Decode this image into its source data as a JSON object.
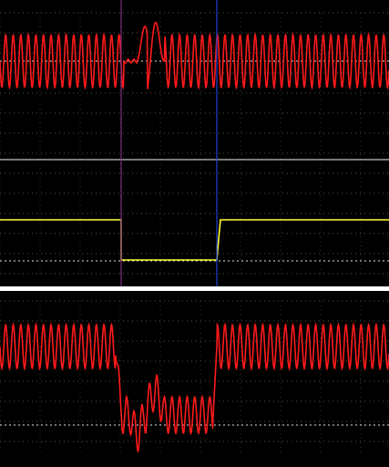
{
  "colors": {
    "background": "#000000",
    "grid": "#3a3a3a",
    "trace_red": "#ff1a1a",
    "trace_yellow": "#ffff33",
    "reference_line": "#ffffff",
    "cursor_a": "#7b2a7b",
    "cursor_b": "#1f3fd6",
    "divider": "#ffffff"
  },
  "panels": [
    {
      "id": "upper",
      "traces": [
        "red-signal-upper",
        "yellow-logic-signal"
      ]
    },
    {
      "id": "lower",
      "traces": [
        "red-signal-lower"
      ]
    }
  ],
  "cursors": [
    {
      "id": "cursor-a",
      "color_key": "cursor_a"
    },
    {
      "id": "cursor-b",
      "color_key": "cursor_b"
    }
  ],
  "icons": [
    "cursor-a-line",
    "cursor-b-line"
  ]
}
